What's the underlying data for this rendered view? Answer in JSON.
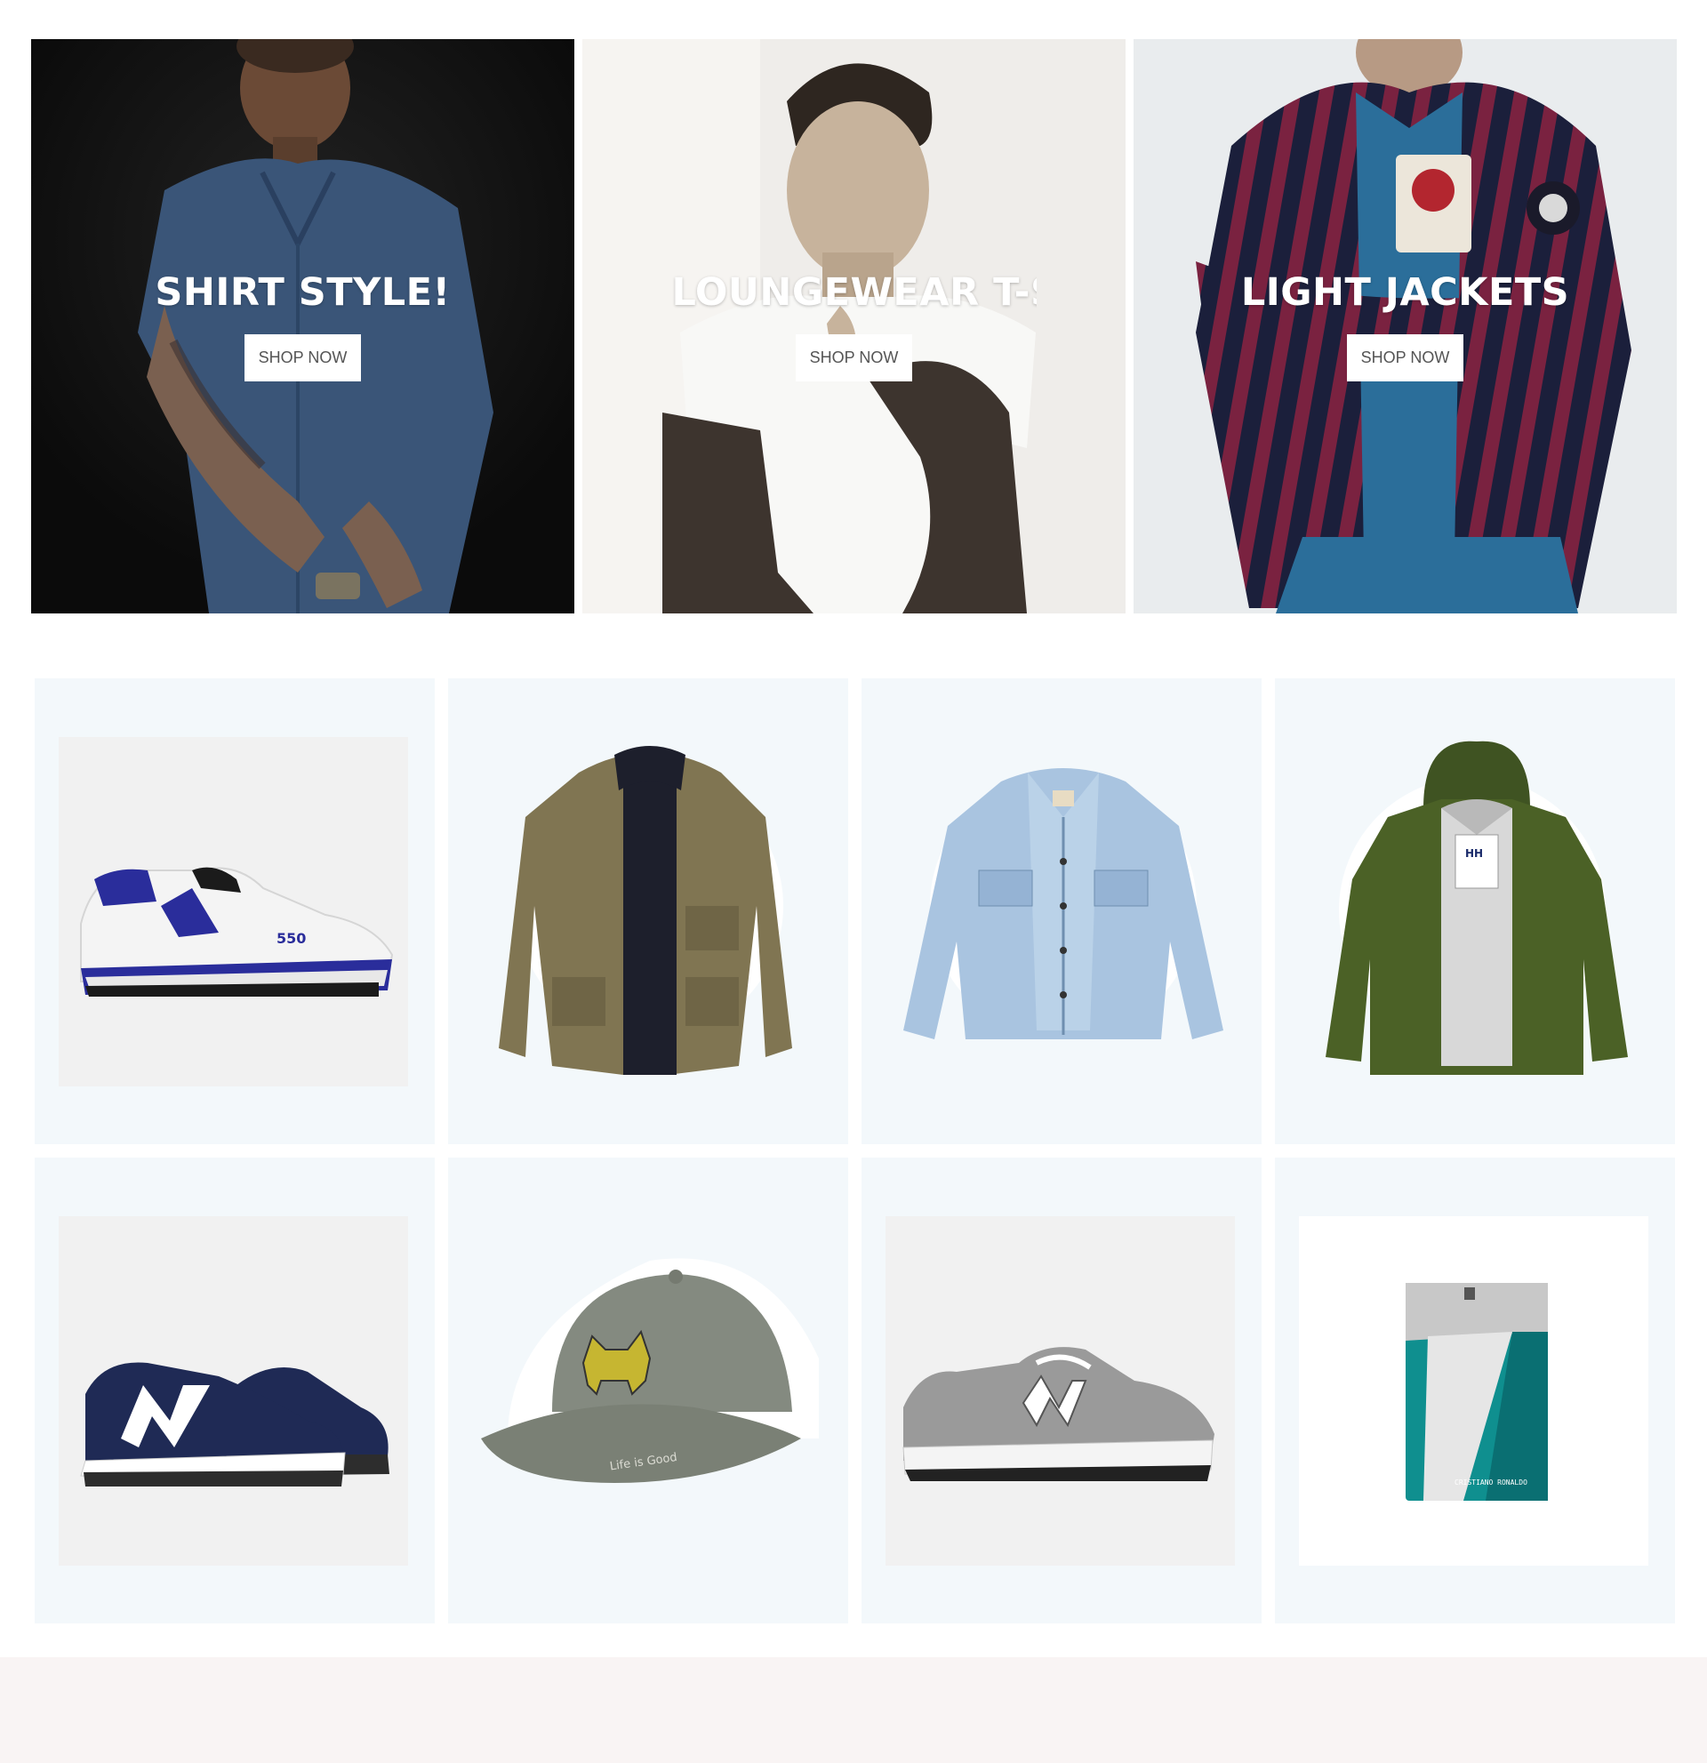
{
  "banners": [
    {
      "title": "SHIRT STYLE!",
      "button": "SHOP NOW"
    },
    {
      "title": "LOUNGEWEAR T-S",
      "button": "SHOP NOW"
    },
    {
      "title": "LIGHT JACKETS",
      "button": "SHOP NOW"
    }
  ],
  "products": [
    {
      "icon": "white-blue-sneaker-icon"
    },
    {
      "icon": "olive-parka-jacket-icon"
    },
    {
      "icon": "denim-jacket-icon"
    },
    {
      "icon": "green-hooded-jacket-icon"
    },
    {
      "icon": "navy-sneakers-icon"
    },
    {
      "icon": "grey-cap-icon",
      "cap_text": "Life is Good"
    },
    {
      "icon": "grey-sneaker-icon"
    },
    {
      "icon": "perfume-bottle-icon",
      "brand_text": "CRISTIANO RONALDO"
    }
  ],
  "colors": {
    "card_bg": "#f3f8fb",
    "footer_bg": "#f9f4f4",
    "button_text": "#555555"
  }
}
